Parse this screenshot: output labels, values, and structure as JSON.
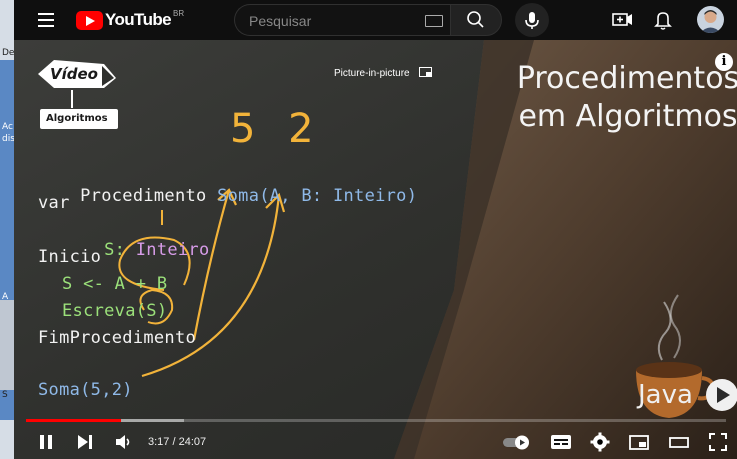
{
  "left_strip": {
    "fragments": [
      "De",
      "Ac",
      "dis",
      "A",
      "S"
    ]
  },
  "header": {
    "logo_text": "YouTube",
    "country_code": "BR",
    "search_placeholder": "Pesquisar",
    "icons": [
      "menu-icon",
      "search-icon",
      "keyboard-icon",
      "mic-icon",
      "create-icon",
      "bell-icon",
      "avatar"
    ]
  },
  "video": {
    "channel_badge_top": "Vídeo",
    "channel_badge_bottom": "Algoritmos",
    "pip_label": "Picture-in-picture",
    "title_line1": "Procedimentos",
    "title_line2": "em Algoritmos",
    "overlay_word": "Java",
    "handwritten_numbers": "5 2",
    "code": {
      "l1_kw": "Procedimento ",
      "l1_sig": "Soma(A, B: Inteiro)",
      "l2": "var",
      "l3_name": "S: ",
      "l3_type": "Inteiro",
      "l4": "Inicio",
      "l5": "S <- A + B",
      "l6": "Escreva(S)",
      "l7": "FimProcedimento",
      "l8": "Soma(5,2)"
    }
  },
  "player": {
    "current_time": "3:17",
    "duration": "24:07",
    "time_display": "3:17 / 24:07",
    "played_fraction": 0.136,
    "buffered_fraction": 0.226,
    "accent_color": "#ff0000",
    "controls": [
      "pause-icon",
      "next-icon",
      "volume-icon",
      "autoplay-toggle",
      "subtitles-icon",
      "settings-icon",
      "miniplayer-icon",
      "theater-icon",
      "fullscreen-icon"
    ]
  }
}
